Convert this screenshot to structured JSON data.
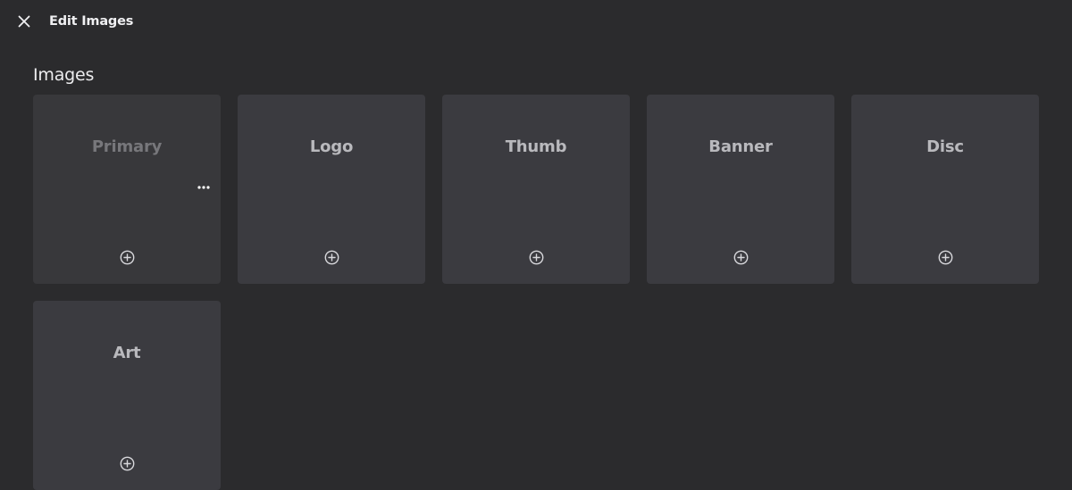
{
  "header": {
    "close_icon": "close-icon",
    "title": "Edit Images"
  },
  "section": {
    "title": "Images"
  },
  "cards": [
    {
      "label": "Primary",
      "state": "dimmed",
      "has_more_menu": true
    },
    {
      "label": "Logo"
    },
    {
      "label": "Thumb"
    },
    {
      "label": "Banner"
    },
    {
      "label": "Disc"
    },
    {
      "label": "Art"
    }
  ],
  "icons": {
    "add": "add-circle-icon",
    "more": "more-horizontal-icon"
  },
  "colors": {
    "background": "#2b2b2d",
    "card": "#3b3b40",
    "card_dim": "#38383b",
    "label": "#b9b9bd",
    "label_dim": "#77777b"
  }
}
